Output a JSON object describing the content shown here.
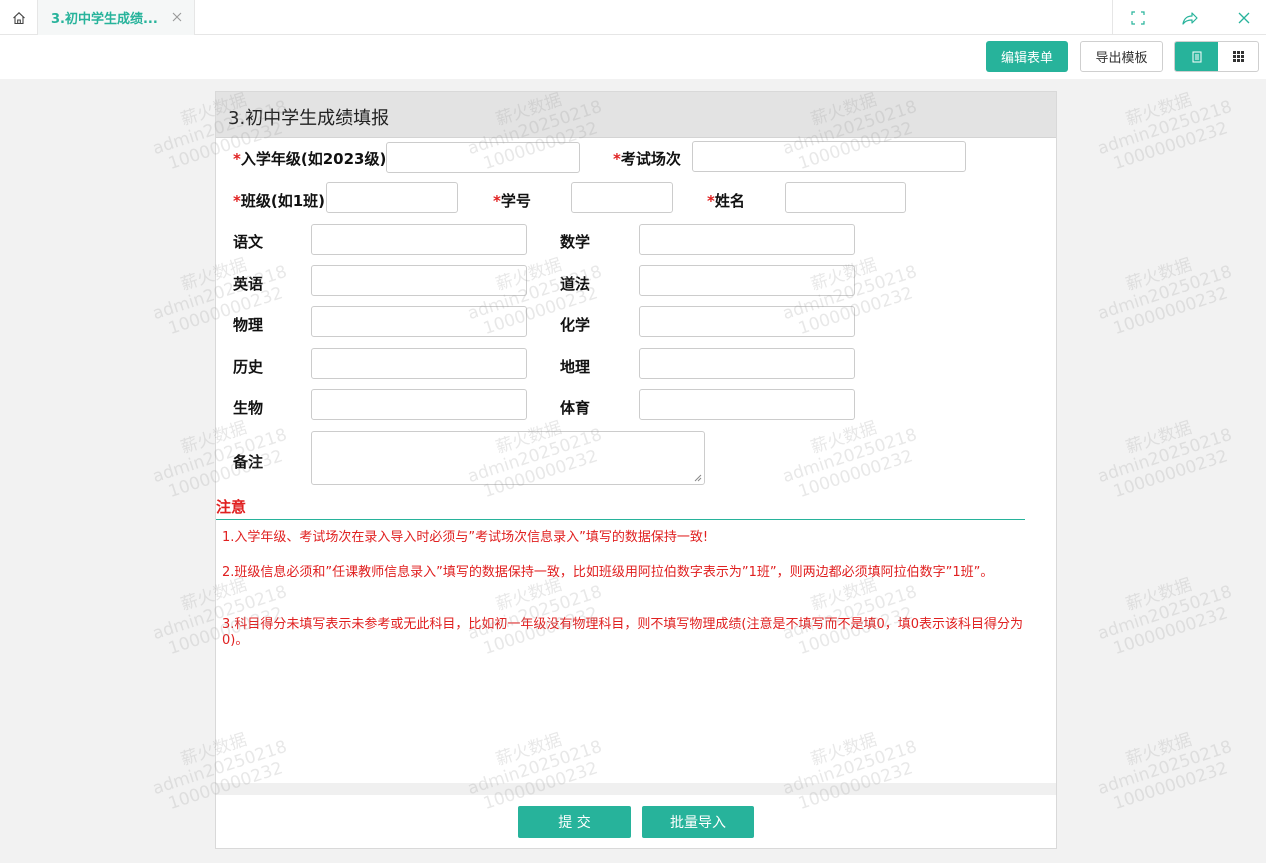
{
  "tabbar": {
    "home_icon": "home-icon",
    "tab_label": "3.初中学生成绩...",
    "tab_close_icon": "close-icon",
    "window_buttons": [
      "fullscreen-icon",
      "share-icon",
      "close-icon"
    ]
  },
  "toolbar": {
    "edit_label": "编辑表单",
    "export_label": "导出模板",
    "view_list_icon": "list-view-icon",
    "view_grid_icon": "grid-view-icon"
  },
  "form": {
    "title": "3.初中学生成绩填报",
    "required_mark": "*",
    "fields": {
      "enroll_grade": {
        "label": "入学年级(如2023级)",
        "value": ""
      },
      "exam_session": {
        "label": "考试场次",
        "value": ""
      },
      "class": {
        "label": "班级(如1班)",
        "value": ""
      },
      "student_no": {
        "label": "学号",
        "value": ""
      },
      "name": {
        "label": "姓名",
        "value": ""
      },
      "chinese": {
        "label": "语文",
        "value": ""
      },
      "math": {
        "label": "数学",
        "value": ""
      },
      "english": {
        "label": "英语",
        "value": ""
      },
      "morality_law": {
        "label": "道法",
        "value": ""
      },
      "physics": {
        "label": "物理",
        "value": ""
      },
      "chemistry": {
        "label": "化学",
        "value": ""
      },
      "history": {
        "label": "历史",
        "value": ""
      },
      "geography": {
        "label": "地理",
        "value": ""
      },
      "biology": {
        "label": "生物",
        "value": ""
      },
      "pe": {
        "label": "体育",
        "value": ""
      },
      "remark": {
        "label": "备注",
        "value": ""
      }
    },
    "notice": {
      "title": "注意",
      "items": [
        "1.入学年级、考试场次在录入导入时必须与”考试场次信息录入”填写的数据保持一致!",
        "2.班级信息必须和”任课教师信息录入”填写的数据保持一致，比如班级用阿拉伯数字表示为”1班”，则两边都必须填阿拉伯数字”1班”。",
        "3.科目得分未填写表示未参考或无此科目，比如初一年级没有物理科目，则不填写物理成绩(注意是不填写而不是填0，填0表示该科目得分为0)。"
      ]
    },
    "submit_label": "提 交",
    "batch_import_label": "批量导入"
  },
  "watermark": [
    "薪火数据",
    "admin20250218",
    "10000000232"
  ],
  "colors": {
    "accent": "#27b39b",
    "required": "#e02020"
  }
}
